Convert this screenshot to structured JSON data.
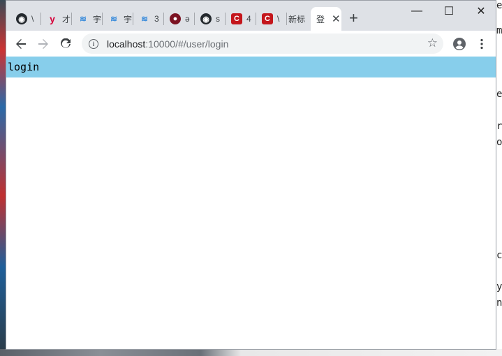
{
  "tabs": [
    {
      "favicon": "github-icon",
      "title": "\\"
    },
    {
      "favicon": "yii-icon",
      "title": "才"
    },
    {
      "favicon": "confluence-icon",
      "title": "宇"
    },
    {
      "favicon": "confluence-icon",
      "title": "宇"
    },
    {
      "favicon": "confluence-icon",
      "title": "3"
    },
    {
      "favicon": "ruby-icon",
      "title": "ǝ"
    },
    {
      "favicon": "github-icon",
      "title": "s"
    },
    {
      "favicon": "csdn-icon",
      "title": "4"
    },
    {
      "favicon": "csdn-icon",
      "title": "\\"
    },
    {
      "favicon": "",
      "title": "新标"
    },
    {
      "favicon": "",
      "title": "登",
      "active": true
    }
  ],
  "toolbar": {
    "url_host": "localhost",
    "url_path": ":10000/#/user/login"
  },
  "page": {
    "heading": "login",
    "heading_bg": "#87ceeb"
  },
  "desktop_right": {
    "chars": [
      "e",
      "m",
      "e",
      "r",
      "o",
      "c",
      "y",
      "n"
    ]
  },
  "window_controls": {
    "minimize": "—",
    "maximize": "☐",
    "close": "✕"
  }
}
